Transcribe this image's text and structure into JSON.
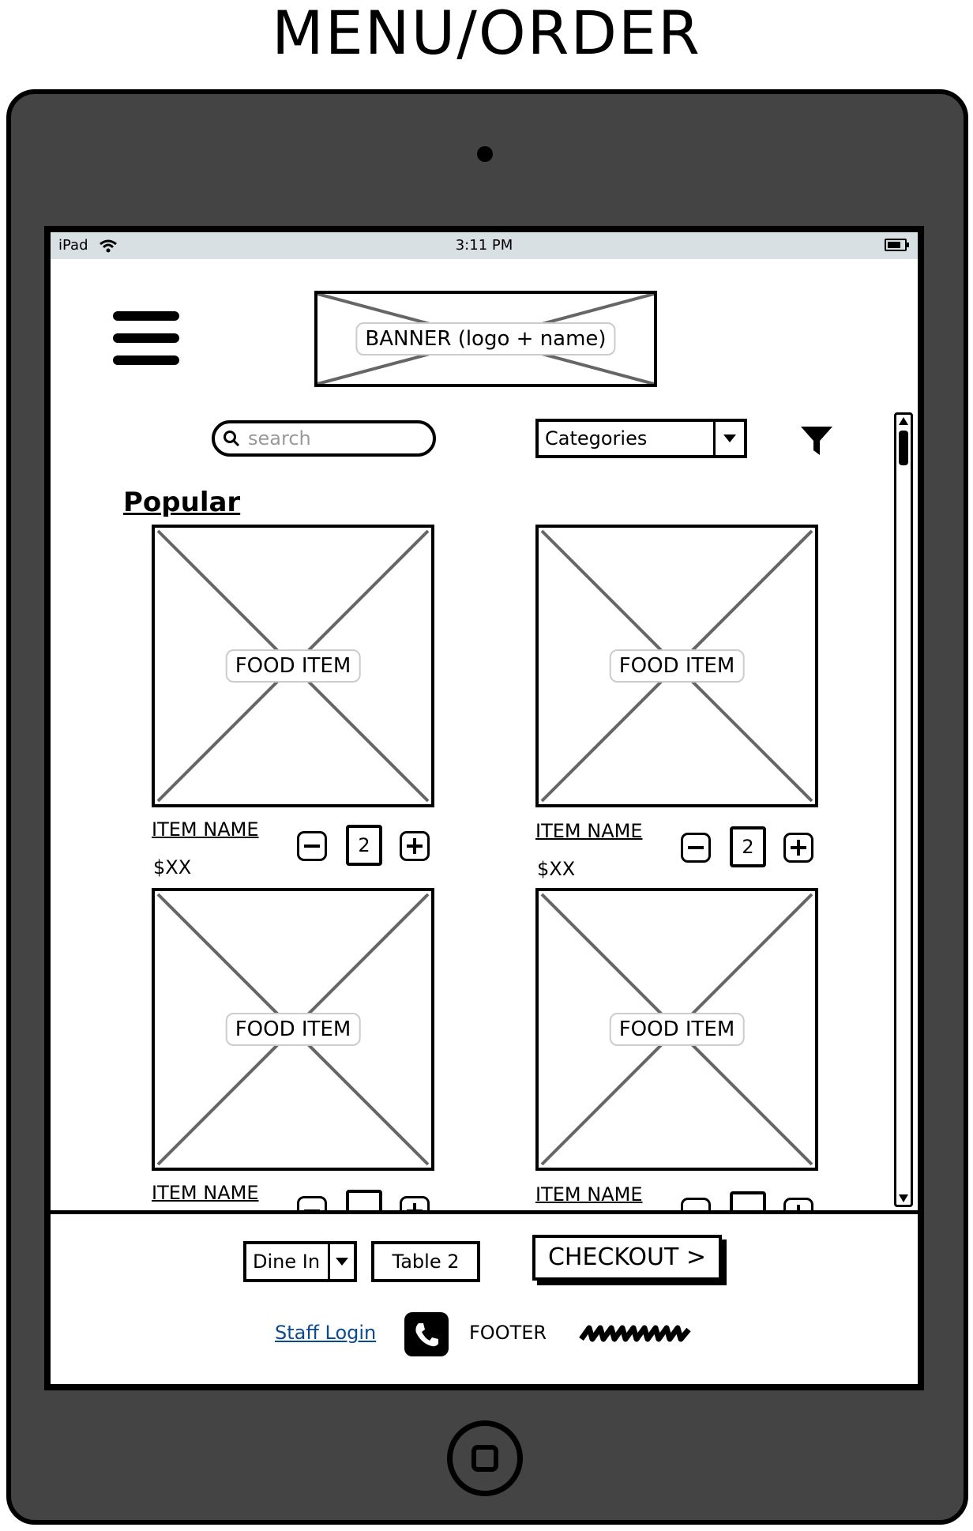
{
  "page_title": "MENU/ORDER",
  "status_bar": {
    "device": "iPad",
    "time": "3:11 PM"
  },
  "header": {
    "banner_label": "BANNER (logo + name)"
  },
  "toolbar": {
    "search_placeholder": "search",
    "categories_selected": "Categories"
  },
  "section_title": "Popular",
  "items": [
    {
      "image_label": "FOOD ITEM",
      "name": "ITEM NAME",
      "price": "$XX",
      "quantity": "2"
    },
    {
      "image_label": "FOOD ITEM",
      "name": "ITEM NAME",
      "price": "$XX",
      "quantity": "2"
    },
    {
      "image_label": "FOOD ITEM",
      "name": "ITEM NAME"
    },
    {
      "image_label": "FOOD ITEM",
      "name": "ITEM NAME"
    }
  ],
  "footer": {
    "dine_option": "Dine In",
    "table_label": "Table 2",
    "checkout_label": "CHECKOUT >",
    "staff_login": "Staff Login",
    "footer_label": "FOOTER"
  },
  "icons": [
    "menu-icon",
    "search-icon",
    "chevron-down-icon",
    "filter-icon",
    "minus-icon",
    "plus-icon",
    "phone-icon",
    "wifi-icon",
    "battery-icon"
  ]
}
